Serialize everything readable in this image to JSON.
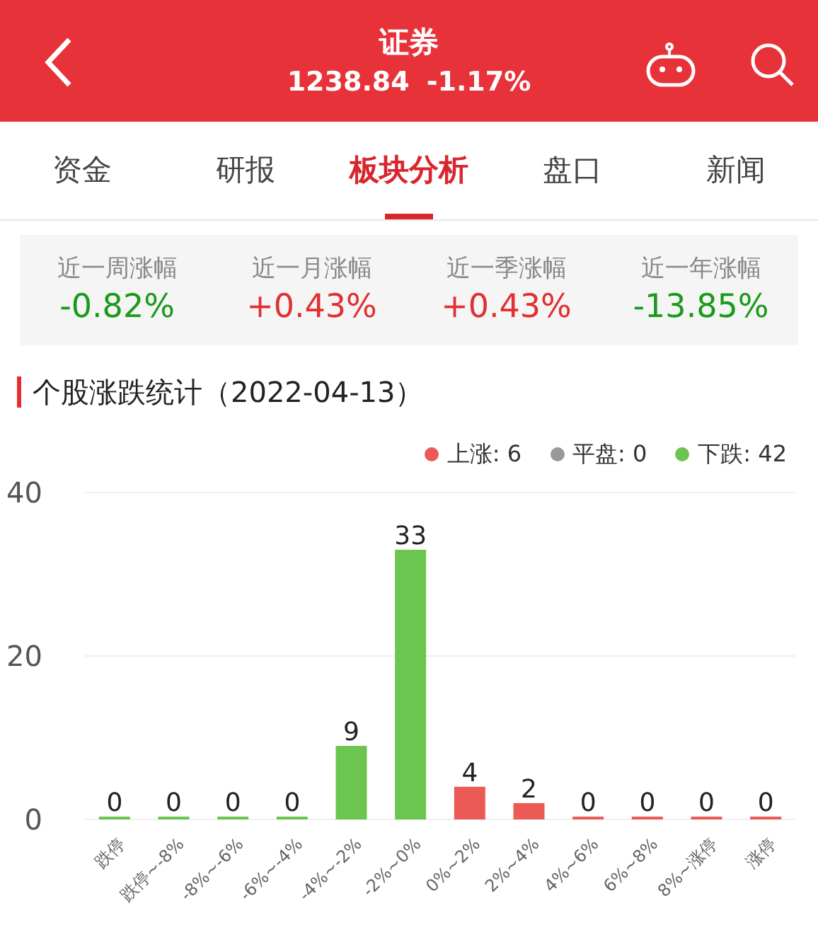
{
  "header": {
    "title": "证券",
    "price": "1238.84",
    "change": "-1.17%"
  },
  "tabs": [
    {
      "label": "资金",
      "selected": false
    },
    {
      "label": "研报",
      "selected": false
    },
    {
      "label": "板块分析",
      "selected": true
    },
    {
      "label": "盘口",
      "selected": false
    },
    {
      "label": "新闻",
      "selected": false
    }
  ],
  "stats": [
    {
      "label": "近一周涨幅",
      "value": "-0.82%",
      "color": "#1a9a1a"
    },
    {
      "label": "近一月涨幅",
      "value": "+0.43%",
      "color": "#e0302f"
    },
    {
      "label": "近一季涨幅",
      "value": "+0.43%",
      "color": "#e0302f"
    },
    {
      "label": "近一年涨幅",
      "value": "-13.85%",
      "color": "#1a9a1a"
    }
  ],
  "section": {
    "title": "个股涨跌统计（2022-04-13）"
  },
  "legend": [
    {
      "count": ": 6"
    },
    {
      "count": ": 0"
    },
    {
      "count": ": 42"
    }
  ],
  "chart_data": {
    "type": "bar",
    "categories": [
      "跌停",
      "跌停~-8%",
      "-8%~-6%",
      "-6%~-4%",
      "-4%~-2%",
      "-2%~0%",
      "0%~2%",
      "2%~4%",
      "4%~6%",
      "6%~8%",
      "8%~涨停",
      "涨停"
    ],
    "series": [
      {
        "name": "上涨",
        "color": "#ec5a55",
        "values": [
          null,
          null,
          null,
          null,
          null,
          null,
          4,
          2,
          0,
          0,
          0,
          0
        ]
      },
      {
        "name": "平盘",
        "color": "#999999",
        "values": [
          null,
          null,
          null,
          null,
          null,
          null,
          null,
          null,
          null,
          null,
          null,
          null
        ]
      },
      {
        "name": "下跌",
        "color": "#6cc54f",
        "values": [
          0,
          0,
          0,
          0,
          9,
          33,
          null,
          null,
          null,
          null,
          null,
          null
        ]
      }
    ],
    "ylim": [
      0,
      40
    ],
    "yticks": [
      0,
      20,
      40
    ],
    "data_labels": true
  }
}
